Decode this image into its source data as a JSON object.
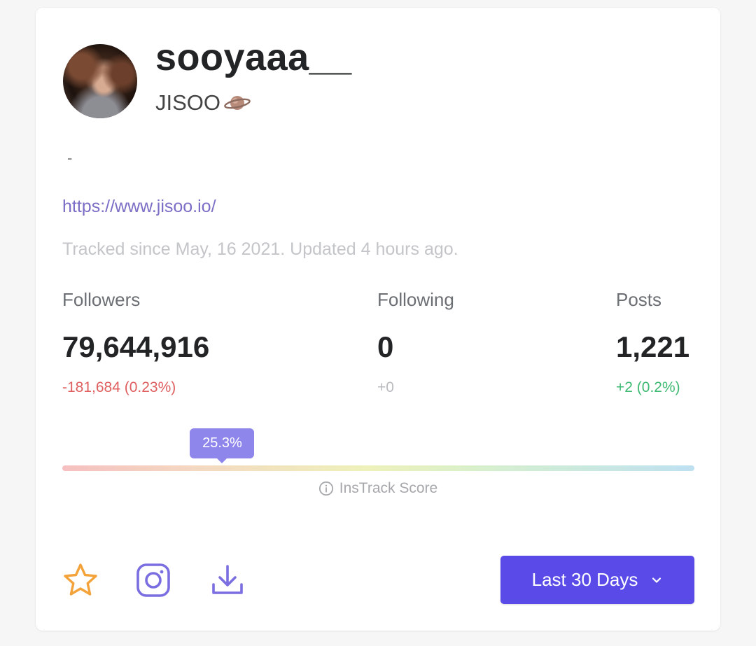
{
  "profile": {
    "username": "sooyaaa__",
    "display_name": "JISOO",
    "display_emoji": "planet-icon",
    "bio": "-",
    "link": "https://www.jisoo.io/",
    "tracked_text": "Tracked since May, 16 2021. Updated 4 hours ago."
  },
  "stats": {
    "followers": {
      "label": "Followers",
      "value": "79,644,916",
      "delta": "-181,684 (0.23%)"
    },
    "following": {
      "label": "Following",
      "value": "0",
      "delta": "+0"
    },
    "posts": {
      "label": "Posts",
      "value": "1,221",
      "delta": "+2 (0.2%)"
    }
  },
  "score": {
    "value_label": "25.3%",
    "value": 0.253,
    "label": "InsTrack Score"
  },
  "actions": {
    "icons": [
      "star-icon",
      "instagram-icon",
      "download-icon"
    ],
    "range_button": "Last 30 Days"
  },
  "colors": {
    "accent": "#5a4ae8",
    "negative": "#df5f5f",
    "positive": "#3fba73",
    "star": "#f4a23a",
    "icon": "#7a6ee0"
  }
}
